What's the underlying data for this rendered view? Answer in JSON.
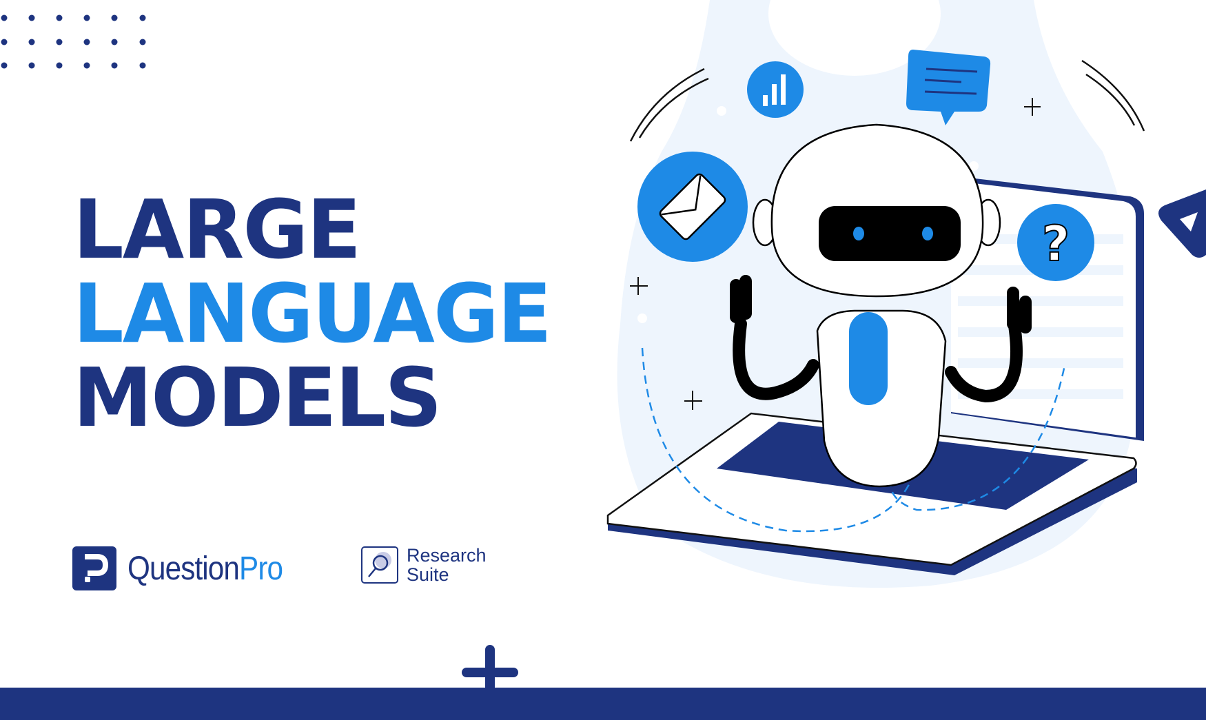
{
  "title": {
    "line1": "LARGE",
    "line2": "LANGUAGE",
    "line3": "MODELS"
  },
  "brand": {
    "questionpro_part1": "Question",
    "questionpro_part2": "Pro",
    "research_suite_line1": "Research",
    "research_suite_line2": "Suite"
  },
  "illustration": {
    "icons": [
      "bar-chart-icon",
      "chat-bubble-icon",
      "mail-icon",
      "question-icon",
      "play-icon"
    ]
  },
  "colors": {
    "navy": "#1e3480",
    "blue": "#1e8ae6",
    "pale": "#eef5fd"
  }
}
